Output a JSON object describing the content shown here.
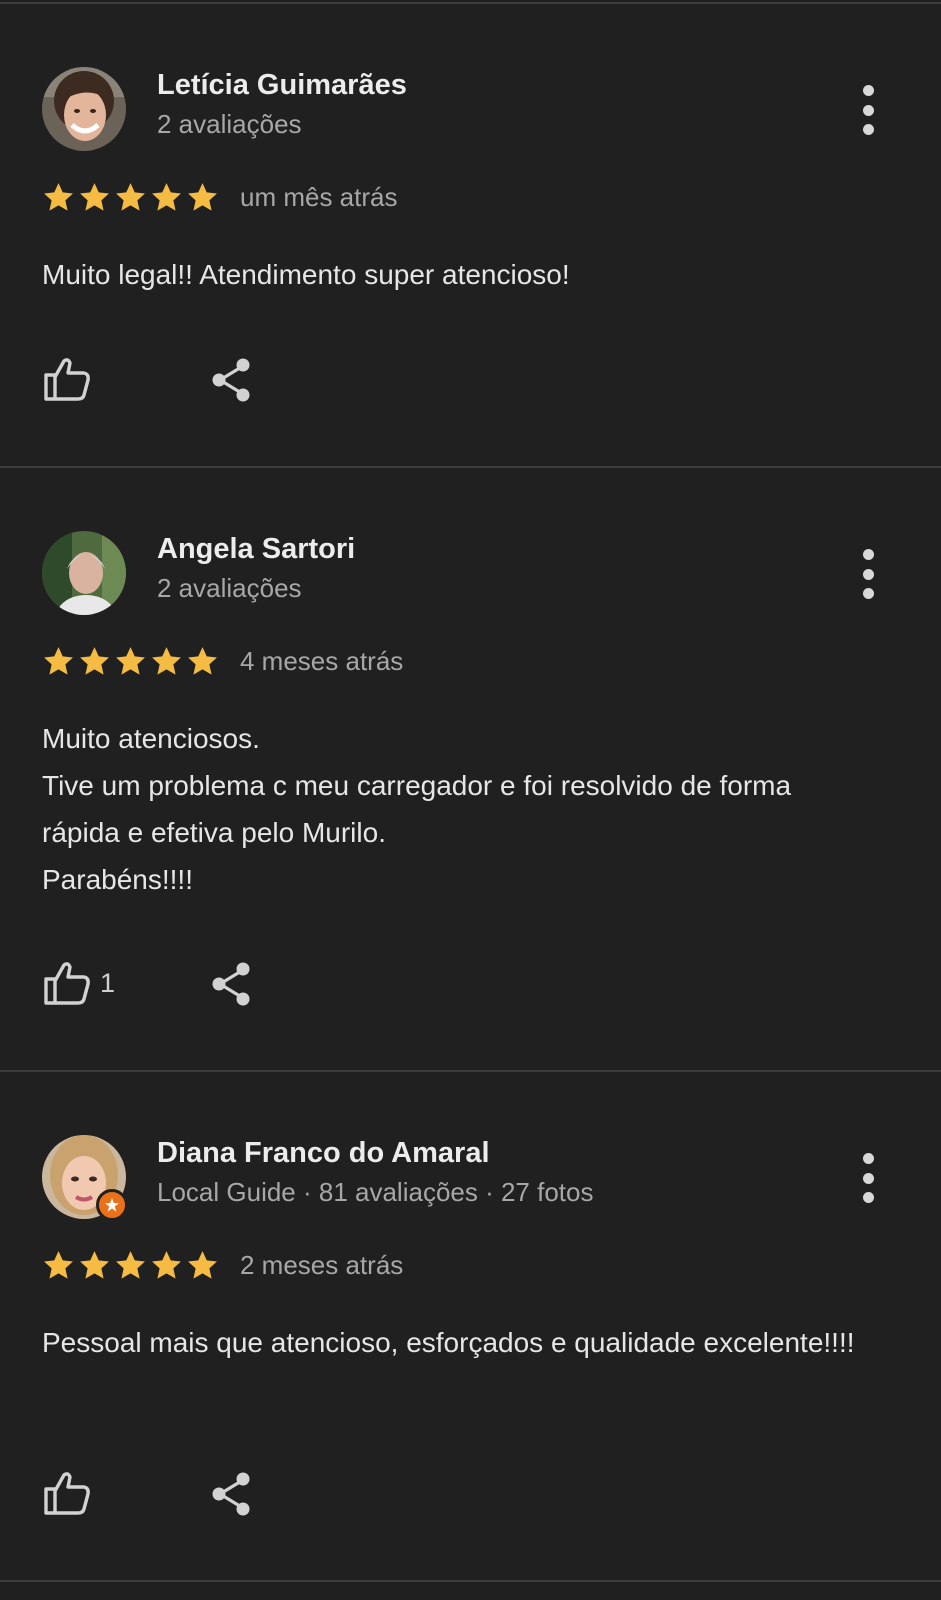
{
  "colors": {
    "background": "#202020",
    "star": "#f6bb42",
    "badge": "#e8711a",
    "name": "#ececec",
    "secondary": "#a7a7a7",
    "body": "#e6e6e6"
  },
  "icons": {
    "more": "more-vertical-icon",
    "like": "thumb-up-icon",
    "share": "share-icon",
    "star": "star-icon",
    "local_guide": "local-guide-badge-icon"
  },
  "reviews": [
    {
      "author": "Letícia Guimarães",
      "meta": "2 avaliações",
      "rating": 5,
      "date": "um mês atrás",
      "text": "Muito legal!! Atendimento super atencioso!",
      "likes": ""
    },
    {
      "author": "Angela Sartori",
      "meta": "2 avaliações",
      "rating": 5,
      "date": "4 meses atrás",
      "text": "Muito atenciosos.\nTive um problema c meu carregador e foi resolvido de forma rápida e efetiva pelo Murilo.\nParabéns!!!!",
      "likes": "1"
    },
    {
      "author": "Diana Franco do Amaral",
      "meta": "Local Guide · 81 avaliações · 27 fotos",
      "rating": 5,
      "date": "2 meses atrás",
      "text": "Pessoal mais que atencioso, esforçados e qualidade excelente!!!!",
      "likes": ""
    }
  ]
}
